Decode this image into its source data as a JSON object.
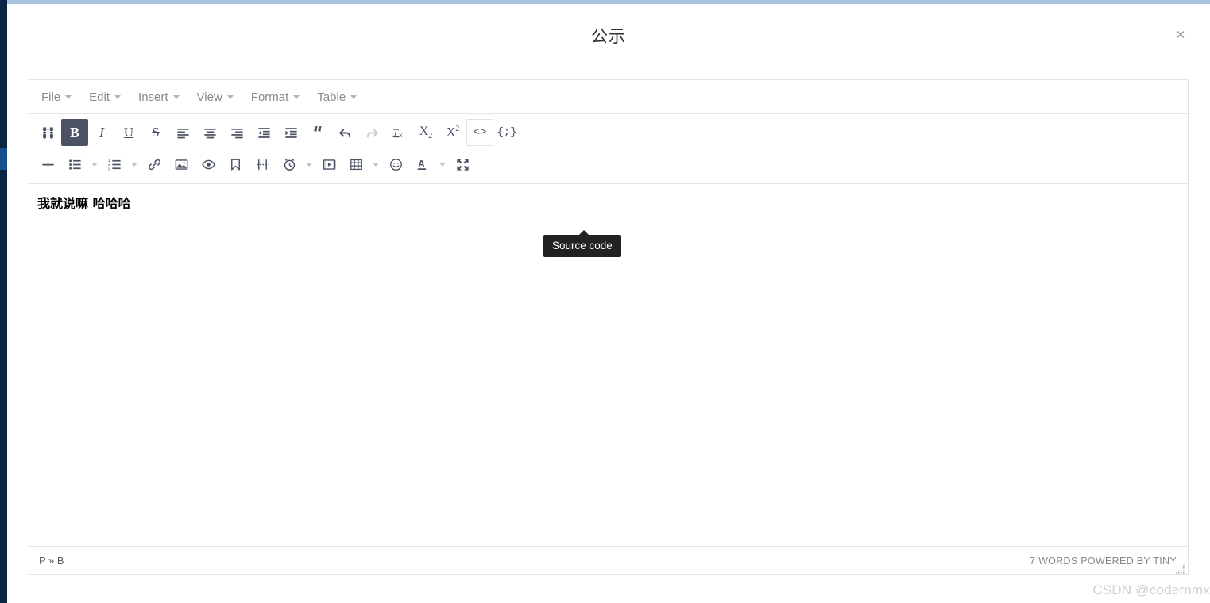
{
  "window": {
    "title": "公示",
    "close_label": "×"
  },
  "menubar": {
    "items": [
      {
        "label": "File",
        "name": "menu-file"
      },
      {
        "label": "Edit",
        "name": "menu-edit"
      },
      {
        "label": "Insert",
        "name": "menu-insert"
      },
      {
        "label": "View",
        "name": "menu-view"
      },
      {
        "label": "Format",
        "name": "menu-format"
      },
      {
        "label": "Table",
        "name": "menu-table"
      }
    ]
  },
  "toolbar": {
    "row1": [
      {
        "icon": "search-replace-icon",
        "title": "Find and replace",
        "active": false
      },
      {
        "icon": "bold-icon",
        "title": "Bold",
        "active": true
      },
      {
        "icon": "italic-icon",
        "title": "Italic",
        "active": false
      },
      {
        "icon": "underline-icon",
        "title": "Underline",
        "active": false
      },
      {
        "icon": "strikethrough-icon",
        "title": "Strikethrough",
        "active": false
      },
      {
        "icon": "align-left-icon",
        "title": "Align left",
        "active": false
      },
      {
        "icon": "align-center-icon",
        "title": "Align center",
        "active": false
      },
      {
        "icon": "align-right-icon",
        "title": "Align right",
        "active": false
      },
      {
        "icon": "outdent-icon",
        "title": "Decrease indent",
        "active": false
      },
      {
        "icon": "indent-icon",
        "title": "Increase indent",
        "active": false
      },
      {
        "icon": "blockquote-icon",
        "title": "Blockquote",
        "active": false
      },
      {
        "icon": "undo-icon",
        "title": "Undo",
        "active": false
      },
      {
        "icon": "redo-icon",
        "title": "Redo",
        "active": false
      },
      {
        "icon": "remove-format-icon",
        "title": "Clear formatting",
        "active": false
      },
      {
        "icon": "subscript-icon",
        "title": "Subscript",
        "active": false
      },
      {
        "icon": "superscript-icon",
        "title": "Superscript",
        "active": false
      },
      {
        "icon": "source-code-icon",
        "title": "Source code",
        "active": false
      },
      {
        "icon": "code-sample-icon",
        "title": "Code sample",
        "active": false
      }
    ],
    "row2": [
      {
        "icon": "horizontal-rule-icon",
        "title": "Horizontal line",
        "caret": false
      },
      {
        "icon": "bullet-list-icon",
        "title": "Bullet list",
        "caret": true
      },
      {
        "icon": "numbered-list-icon",
        "title": "Numbered list",
        "caret": true
      },
      {
        "icon": "link-icon",
        "title": "Insert/edit link",
        "caret": false
      },
      {
        "icon": "image-icon",
        "title": "Insert/edit image",
        "caret": false
      },
      {
        "icon": "preview-icon",
        "title": "Preview",
        "caret": false
      },
      {
        "icon": "anchor-icon",
        "title": "Anchor",
        "caret": false
      },
      {
        "icon": "page-break-icon",
        "title": "Page break",
        "caret": false
      },
      {
        "icon": "insert-datetime-icon",
        "title": "Insert date/time",
        "caret": true
      },
      {
        "icon": "media-icon",
        "title": "Insert/edit media",
        "caret": false
      },
      {
        "icon": "table-icon",
        "title": "Table",
        "caret": true
      },
      {
        "icon": "emoticons-icon",
        "title": "Emoticons",
        "caret": false
      },
      {
        "icon": "text-color-icon",
        "title": "Text color",
        "caret": true
      },
      {
        "icon": "fullscreen-icon",
        "title": "Fullscreen",
        "caret": false
      }
    ]
  },
  "tooltip": {
    "text": "Source code"
  },
  "content": {
    "body_text": "我就说嘛 哈哈哈"
  },
  "statusbar": {
    "element_path": "P » B",
    "branding": "7 WORDS POWERED BY TINY"
  },
  "watermark": {
    "text": "CSDN @codernmx"
  },
  "colors": {
    "accent_rail": "#0b2545",
    "rail_active": "#14508f",
    "top_band": "#a8c4de",
    "toolbar_icon": "#4a5264",
    "active_button_bg": "#4a5264",
    "tooltip_bg": "#222222"
  }
}
